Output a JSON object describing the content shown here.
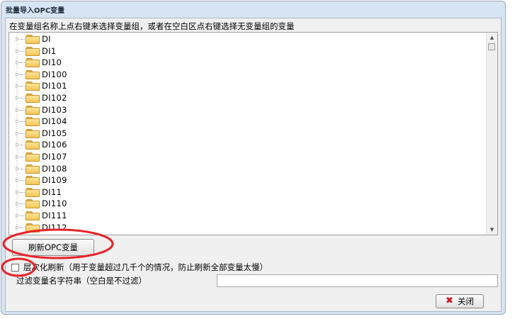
{
  "window": {
    "title": "批量导入OPC变量"
  },
  "instruction": "在变量组名称上点右键来选择变量组，或者在空白区点右键选择无变量组的变量",
  "tree": {
    "items": [
      "DI",
      "DI1",
      "DI10",
      "DI100",
      "DI101",
      "DI102",
      "DI103",
      "DI104",
      "DI105",
      "DI106",
      "DI107",
      "DI108",
      "DI109",
      "DI11",
      "DI110",
      "DI111",
      "DI112"
    ]
  },
  "buttons": {
    "refresh": "刷新OPC变量",
    "close": "关闭"
  },
  "checkbox": {
    "label": "层次化刷新（用于变量超过几千个的情况，防止刷新全部变量太慢）",
    "checked": false
  },
  "filter": {
    "label": "过滤变量名字符串（空白是不过滤）",
    "value": ""
  },
  "icons": {
    "folder": "folder-icon",
    "expander": "expand-arrow-icon",
    "close": "close-x-icon"
  },
  "colors": {
    "window_bg": "#d7e4f2",
    "client_bg": "#f0f0f0",
    "folder": "#f4c557",
    "annotation": "#e8232a",
    "close_icon": "#c8161d"
  }
}
